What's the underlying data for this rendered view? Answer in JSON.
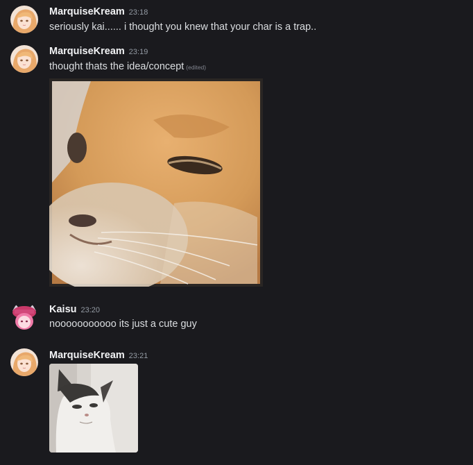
{
  "messages": [
    {
      "author": "MarquiseKream",
      "time": "23:18",
      "text": "seriously kai...... i thought you knew that your char is a trap.."
    },
    {
      "author": "MarquiseKream",
      "time": "23:19",
      "text": "thought thats the idea/concept",
      "edited": "(edited)"
    },
    {
      "author": "Kaisu",
      "time": "23:20",
      "text": "nooooooooooo its just a cute guy"
    },
    {
      "author": "MarquiseKream",
      "time": "23:21"
    }
  ],
  "colors": {
    "background": "#1a1a1e",
    "username": "#f2f3f5",
    "text": "#dbdee1",
    "timestamp": "#949ba4"
  }
}
